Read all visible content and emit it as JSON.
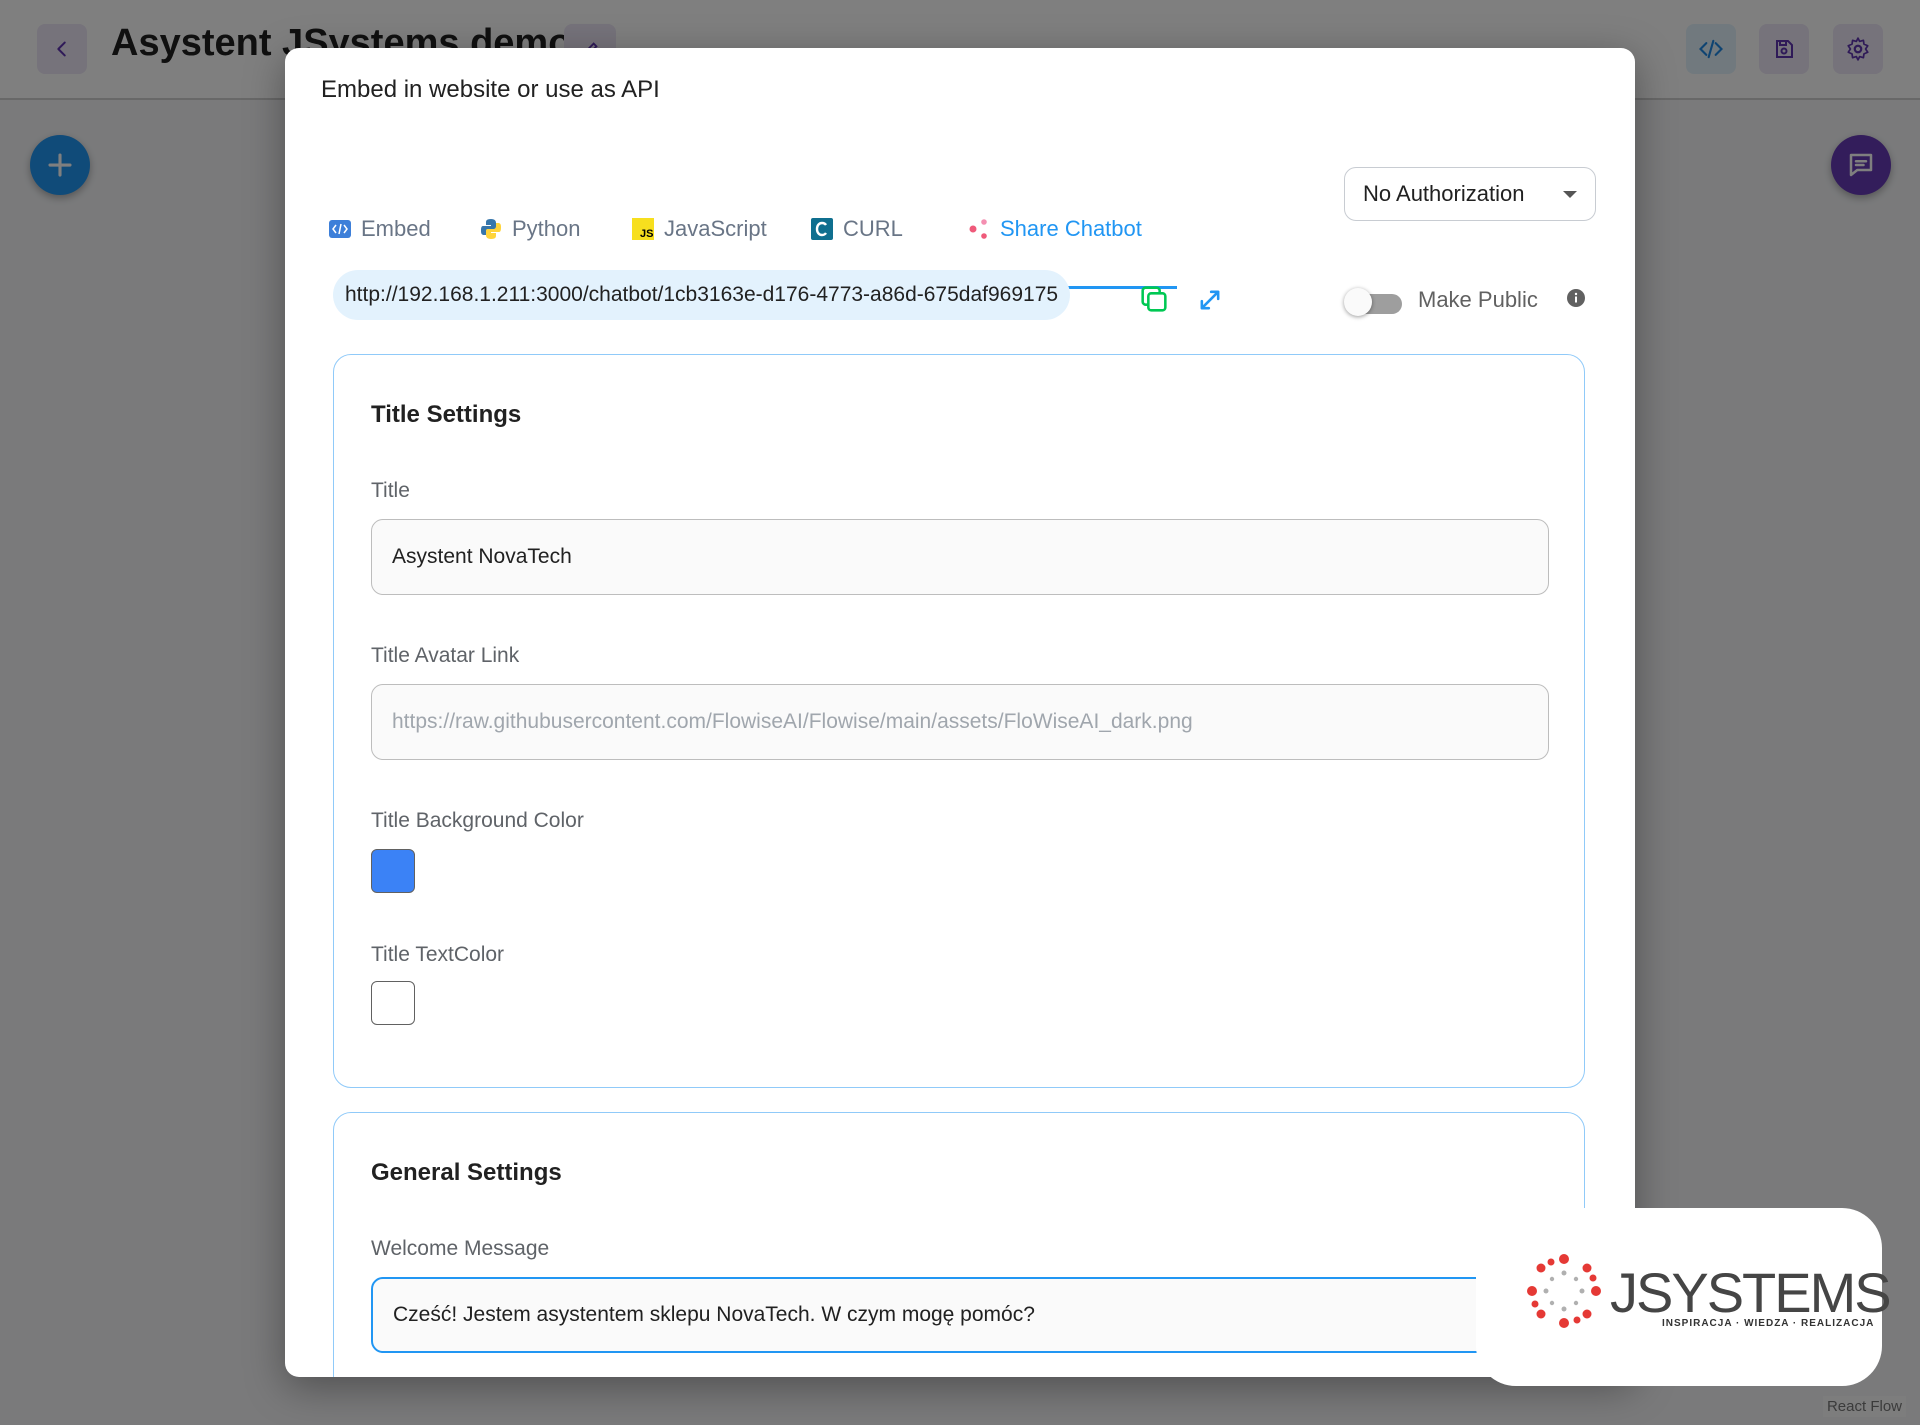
{
  "app": {
    "flow_title": "Asystent JSystems demo",
    "react_flow_attribution": "React Flow"
  },
  "dialog": {
    "title": "Embed in website or use as API",
    "tabs": [
      {
        "label": "Embed",
        "icon": "embed-code-icon",
        "active": false
      },
      {
        "label": "Python",
        "icon": "python-icon",
        "active": false
      },
      {
        "label": "JavaScript",
        "icon": "javascript-icon",
        "active": false
      },
      {
        "label": "CURL",
        "icon": "curl-icon",
        "active": false
      },
      {
        "label": "Share Chatbot",
        "icon": "share-icon",
        "active": true
      }
    ],
    "auth_select": {
      "value": "No Authorization"
    },
    "share_url": "http://192.168.1.211:3000/chatbot/1cb3163e-d176-4773-a86d-675daf969175",
    "make_public": {
      "label": "Make Public",
      "enabled": false
    },
    "title_settings": {
      "heading": "Title Settings",
      "title_label": "Title",
      "title_value": "Asystent NovaTech",
      "avatar_label": "Title Avatar Link",
      "avatar_placeholder": "https://raw.githubusercontent.com/FlowiseAI/Flowise/main/assets/FloWiseAI_dark.png",
      "bg_color_label": "Title Background Color",
      "bg_color": "#3b82f6",
      "text_color_label": "Title TextColor",
      "text_color": "#ffffff"
    },
    "general_settings": {
      "heading": "General Settings",
      "welcome_label": "Welcome Message",
      "welcome_value": "Cześć! Jestem asystentem sklepu NovaTech. W czym mogę pomóc?"
    }
  },
  "watermark": {
    "brand": "JSYSTEMS",
    "tagline": "INSPIRACJA · WIEDZA · REALIZACJA"
  },
  "colors": {
    "accent": "#2196f3",
    "primary_purple": "#673ab7",
    "card_border": "#90caf9",
    "url_chip_bg": "#e3f2fd",
    "copy_green": "#00c853"
  }
}
